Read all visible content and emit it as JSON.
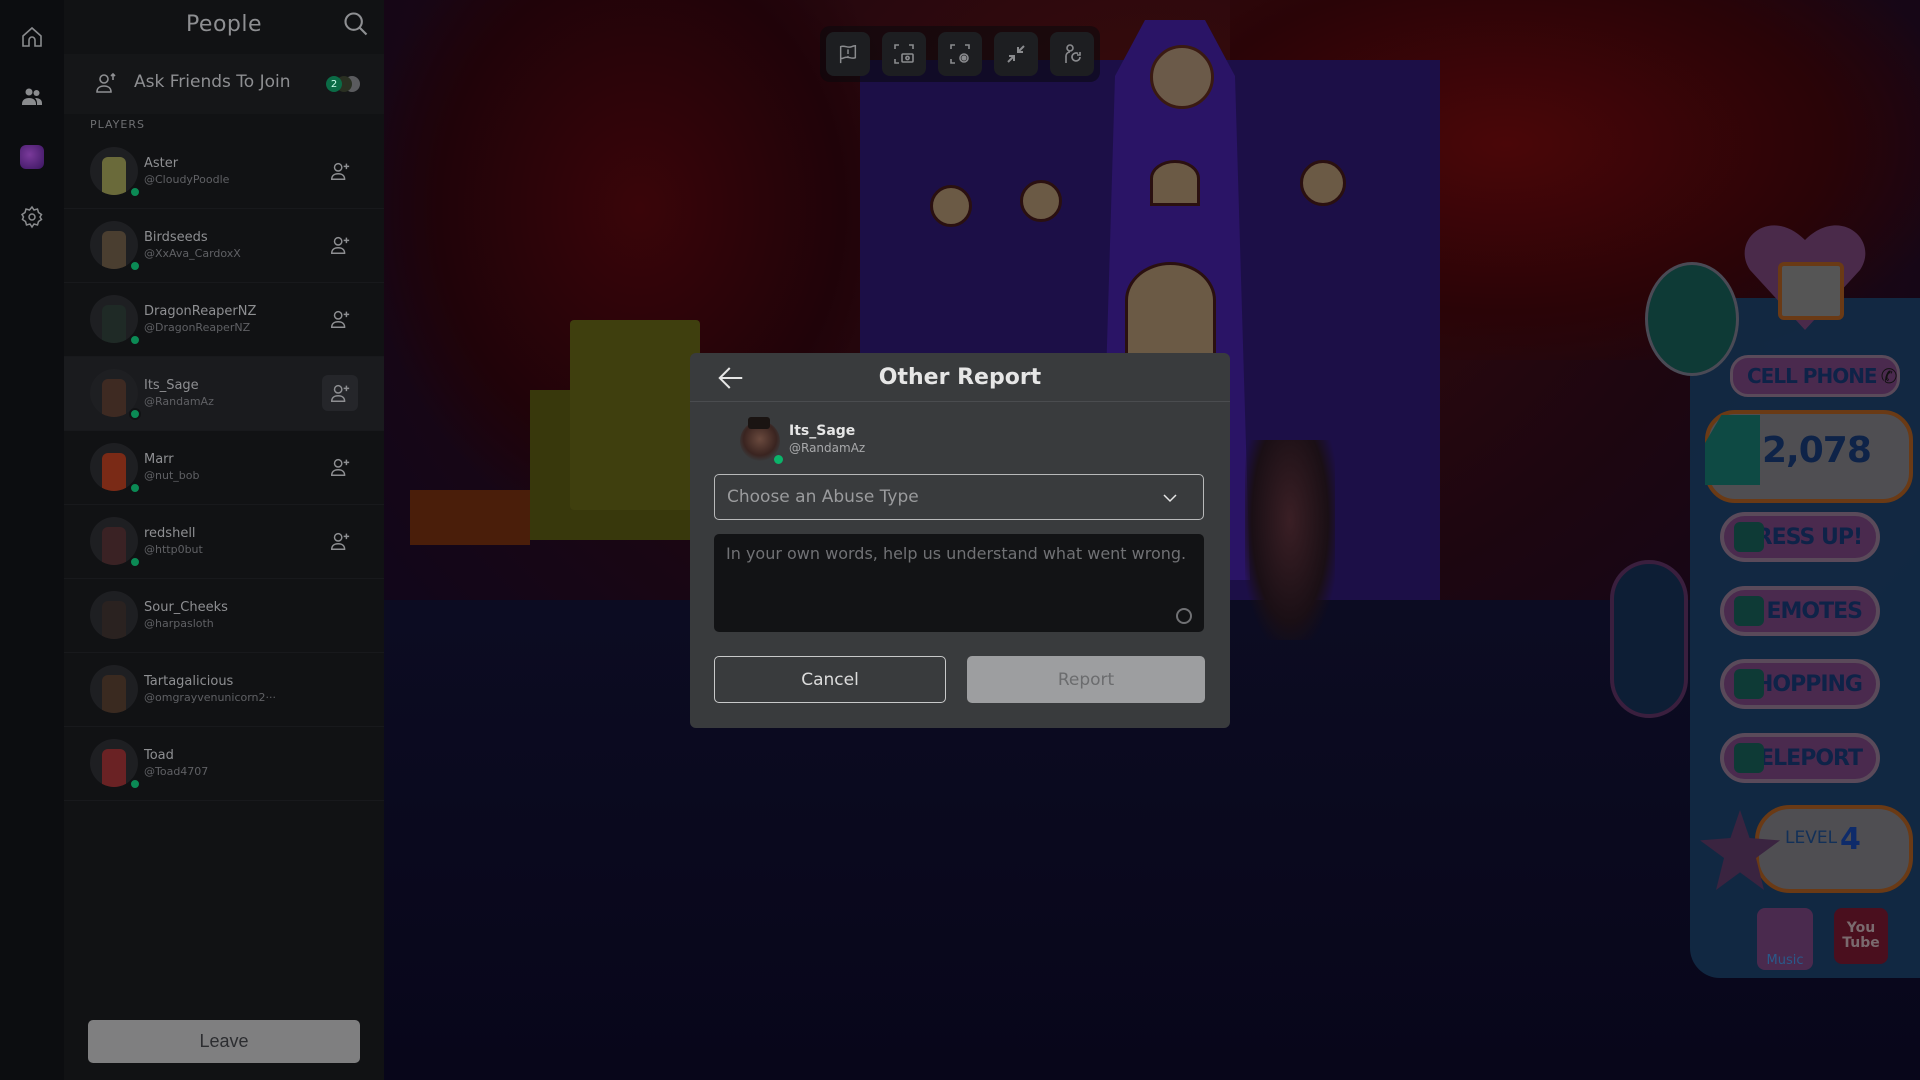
{
  "rail": {
    "items": [
      {
        "name": "home",
        "icon": "home-icon"
      },
      {
        "name": "people",
        "icon": "people-icon"
      },
      {
        "name": "game",
        "icon": "game-thumbnail"
      },
      {
        "name": "settings",
        "icon": "gear-icon"
      }
    ]
  },
  "panel": {
    "title": "People",
    "ask_friends_label": "Ask Friends To Join",
    "ask_friends_count": "2",
    "players_header": "PLAYERS",
    "leave_label": "Leave",
    "players": [
      {
        "name": "Aster",
        "handle": "@CloudyPoodle",
        "online": true,
        "can_add": true,
        "color": "#6a6a3a"
      },
      {
        "name": "Birdseeds",
        "handle": "@XxAva_CardoxX",
        "online": true,
        "can_add": true,
        "color": "#4a3e30"
      },
      {
        "name": "DragonReaperNZ",
        "handle": "@DragonReaperNZ",
        "online": true,
        "can_add": true,
        "color": "#1f2a26"
      },
      {
        "name": "Its_Sage",
        "handle": "@RandamAz",
        "online": true,
        "can_add": true,
        "active": true,
        "color": "#3e2a22"
      },
      {
        "name": "Marr",
        "handle": "@nut_bob",
        "online": true,
        "can_add": true,
        "color": "#7a2a16"
      },
      {
        "name": "redshell",
        "handle": "@http0but",
        "online": true,
        "can_add": true,
        "color": "#3a2224"
      },
      {
        "name": "Sour_Cheeks",
        "handle": "@harpasloth",
        "online": false,
        "can_add": false,
        "color": "#2a2220"
      },
      {
        "name": "Tartagalicious",
        "handle": "@omgrayvenunicorn2···",
        "online": false,
        "can_add": false,
        "color": "#3a2a20"
      },
      {
        "name": "Toad",
        "handle": "@Toad4707",
        "online": true,
        "can_add": false,
        "color": "#6a2224"
      }
    ]
  },
  "toolbar": {
    "buttons": [
      {
        "name": "report",
        "icon": "flag-icon"
      },
      {
        "name": "screenshot",
        "icon": "camera-capture-icon"
      },
      {
        "name": "record",
        "icon": "record-icon"
      },
      {
        "name": "minimize",
        "icon": "minimize-icon"
      },
      {
        "name": "reset-character",
        "icon": "reset-character-icon"
      }
    ]
  },
  "modal": {
    "title": "Other Report",
    "user": {
      "name": "Its_Sage",
      "handle": "@RandamAz",
      "online": true
    },
    "abuse_select_placeholder": "Choose an Abuse Type",
    "description_placeholder": "In your own words, help us understand what went wrong.",
    "description_value": "",
    "cancel_label": "Cancel",
    "report_label": "Report",
    "report_enabled": false
  },
  "hud": {
    "cell_phone_label": "CELL PHONE",
    "gems": "2,078",
    "menu": [
      "DRESS UP!",
      "EMOTES",
      "SHOPPING",
      "TELEPORT"
    ],
    "level_label": "LEVEL",
    "level_value": "4",
    "music_label": "Music",
    "youtube_label_1": "You",
    "youtube_label_2": "Tube"
  },
  "colors": {
    "online": "#0bb36a",
    "panel_bg": "#111214",
    "modal_bg": "#393b3d",
    "report_disabled": "#9d9ea0"
  }
}
